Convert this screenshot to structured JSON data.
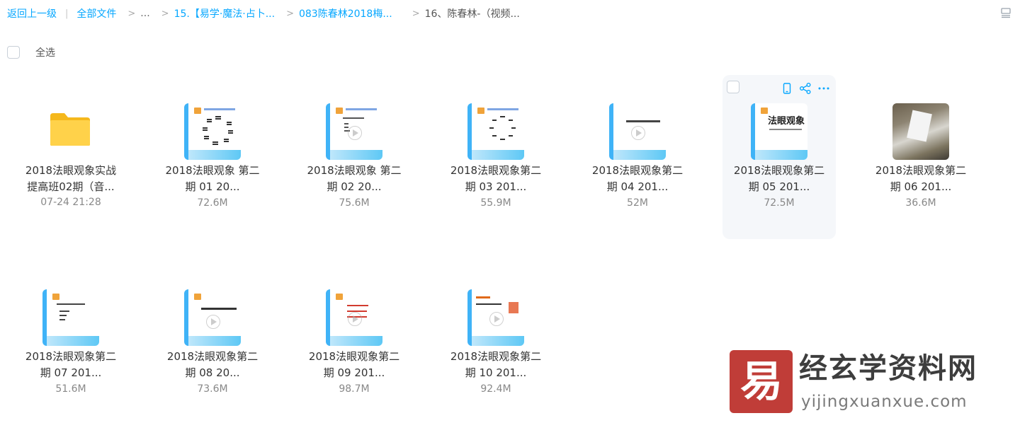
{
  "breadcrumb": {
    "back": "返回上一级",
    "all_files": "全部文件",
    "ellipsis": "...",
    "level1": "15.【易学·魔法·占卜...",
    "level2": "083陈春林2018梅...",
    "current": "16、陈春林-（视频..."
  },
  "select_all_label": "全选",
  "items": [
    {
      "type": "folder",
      "line1": "2018法眼观象实战",
      "line2": "提高班02期（音...",
      "meta": "07-24 21:28"
    },
    {
      "type": "video",
      "line1": "2018法眼观象 第二",
      "line2": "期 01 20...",
      "meta": "72.6M"
    },
    {
      "type": "video",
      "line1": "2018法眼观象 第二",
      "line2": "期 02 20...",
      "meta": "75.6M"
    },
    {
      "type": "video",
      "line1": "2018法眼观象第二",
      "line2": "期 03 201...",
      "meta": "55.9M"
    },
    {
      "type": "video",
      "line1": "2018法眼观象第二",
      "line2": "期 04 201...",
      "meta": "52M"
    },
    {
      "type": "video",
      "line1": "2018法眼观象第二",
      "line2": "期 05 201...",
      "meta": "72.5M",
      "thumb_text": "法眼观象"
    },
    {
      "type": "photo",
      "line1": "2018法眼观象第二",
      "line2": "期 06 201...",
      "meta": "36.6M"
    },
    {
      "type": "video",
      "line1": "2018法眼观象第二",
      "line2": "期 07 201...",
      "meta": "51.6M"
    },
    {
      "type": "video",
      "line1": "2018法眼观象第二",
      "line2": "期 08 20...",
      "meta": "73.6M"
    },
    {
      "type": "video",
      "line1": "2018法眼观象第二",
      "line2": "期 09 201...",
      "meta": "98.7M"
    },
    {
      "type": "video",
      "line1": "2018法眼观象第二",
      "line2": "期 10 201...",
      "meta": "92.4M"
    }
  ],
  "watermark": {
    "title": "经玄学资料网",
    "url": "yijingxuanxue.com"
  },
  "colors": {
    "link": "#06a7ff",
    "hover_bg": "#f5f7fa",
    "watermark_red": "#c03d38"
  }
}
